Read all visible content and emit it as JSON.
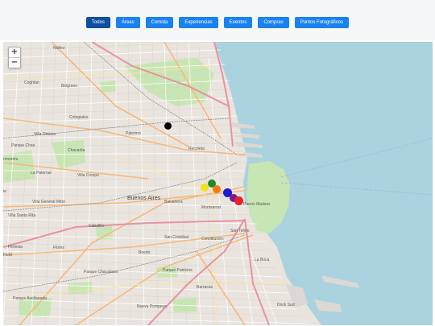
{
  "filters": [
    {
      "label": "Todos",
      "active": true
    },
    {
      "label": "Áreas"
    },
    {
      "label": "Comida"
    },
    {
      "label": "Experiencias"
    },
    {
      "label": "Eventos"
    },
    {
      "label": "Compras"
    },
    {
      "label": "Puntos Fotográficos"
    }
  ],
  "map": {
    "zoom_in": "+",
    "zoom_out": "−",
    "colors": {
      "land": "#e9e4de",
      "water": "#aad3df",
      "park": "#c8e6b3",
      "arterial": "#f6b97c",
      "highway": "#e892a2"
    },
    "labels": {
      "nunez": "Núñez",
      "coghlan": "Coghlan",
      "belgrano": "Belgrano",
      "colegiales": "Colegiales",
      "villa_ortuzar": "Villa Ortúzar",
      "chacarita": "Chacarita",
      "parque_chas": "Parque Chas",
      "agronomia": "Agronomía",
      "palermo": "Palermo",
      "recoleta": "Recoleta",
      "villa_crespo": "Villa Crespo",
      "la_paternal": "La Paternal",
      "buenos_aires": "Buenos Aires",
      "balvanera": "Balvanera",
      "villa_general_mitre": "Villa General Mitre",
      "villa_santa_rita": "Villa Santa Rita",
      "caballito": "Caballito",
      "montserrat": "Montserrat",
      "puerto_madero": "Puerto Madero",
      "san_telmo": "San Telmo",
      "san_cristobal": "San Cristóbal",
      "constitucion": "Constitución",
      "floresta": "Floresta",
      "flores": "Flores",
      "boedo": "Boedo",
      "la_boca": "La Boca",
      "parque_chacabuco": "Parque Chacabuco",
      "parque_patricios": "Parque Patricios",
      "barracas": "Barracas",
      "parque_avellaneda": "Parque Avellaneda",
      "nueva_pompeya": "Nueva Pompeya",
      "dock_sud": "Dock Sud",
      "field": "Field",
      "ronomia": "ronomía",
      "ie": "ie"
    }
  },
  "markers": [
    {
      "name": "black",
      "color": "#000000"
    },
    {
      "name": "green",
      "color": "#1e8a2a"
    },
    {
      "name": "yellow",
      "color": "#f2e21a"
    },
    {
      "name": "orange",
      "color": "#f07d14"
    },
    {
      "name": "blue",
      "color": "#1a1ad8"
    },
    {
      "name": "purple",
      "color": "#7a1a8a"
    },
    {
      "name": "red",
      "color": "#e8222a"
    }
  ]
}
